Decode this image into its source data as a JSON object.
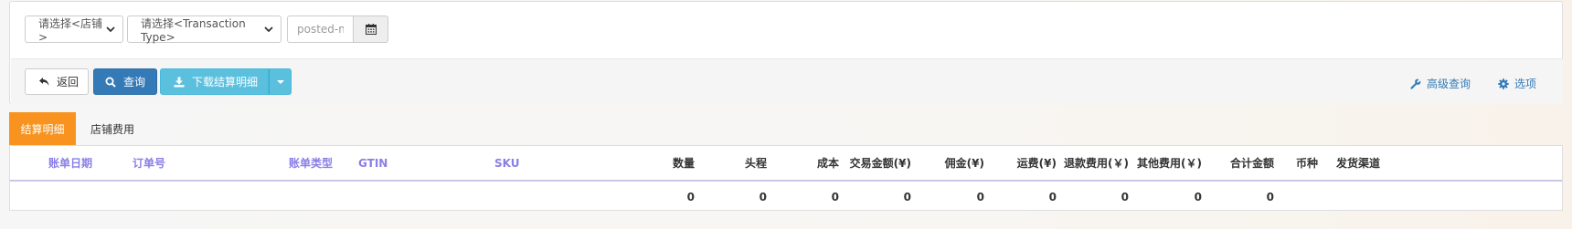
{
  "filters": {
    "store_select": "请选择<店铺>",
    "transaction_select": "请选择<Transaction Type>",
    "date_placeholder": "posted-m"
  },
  "toolbar": {
    "back_label": "返回",
    "search_label": "查询",
    "download_label": "下载结算明细",
    "advanced_search_label": "高级查询",
    "options_label": "选项"
  },
  "tabs": [
    {
      "label": "结算明细",
      "active": true
    },
    {
      "label": "店铺费用",
      "active": false
    }
  ],
  "table": {
    "headers": [
      "账单日期",
      "订单号",
      "账单类型",
      "GTIN",
      "SKU",
      "数量",
      "头程",
      "成本",
      "交易金额(¥)",
      "佣金(¥)",
      "运费(¥)",
      "退款费用(￥)",
      "其他费用(￥)",
      "合计金额",
      "币种",
      "发货渠道"
    ],
    "totals": [
      "0",
      "0",
      "0",
      "0",
      "0",
      "0",
      "0",
      "0",
      "0"
    ]
  },
  "colors": {
    "primary": "#337ab7",
    "info": "#5bc0de",
    "active_tab": "#f7931e",
    "header_link": "#8a7fe6"
  }
}
